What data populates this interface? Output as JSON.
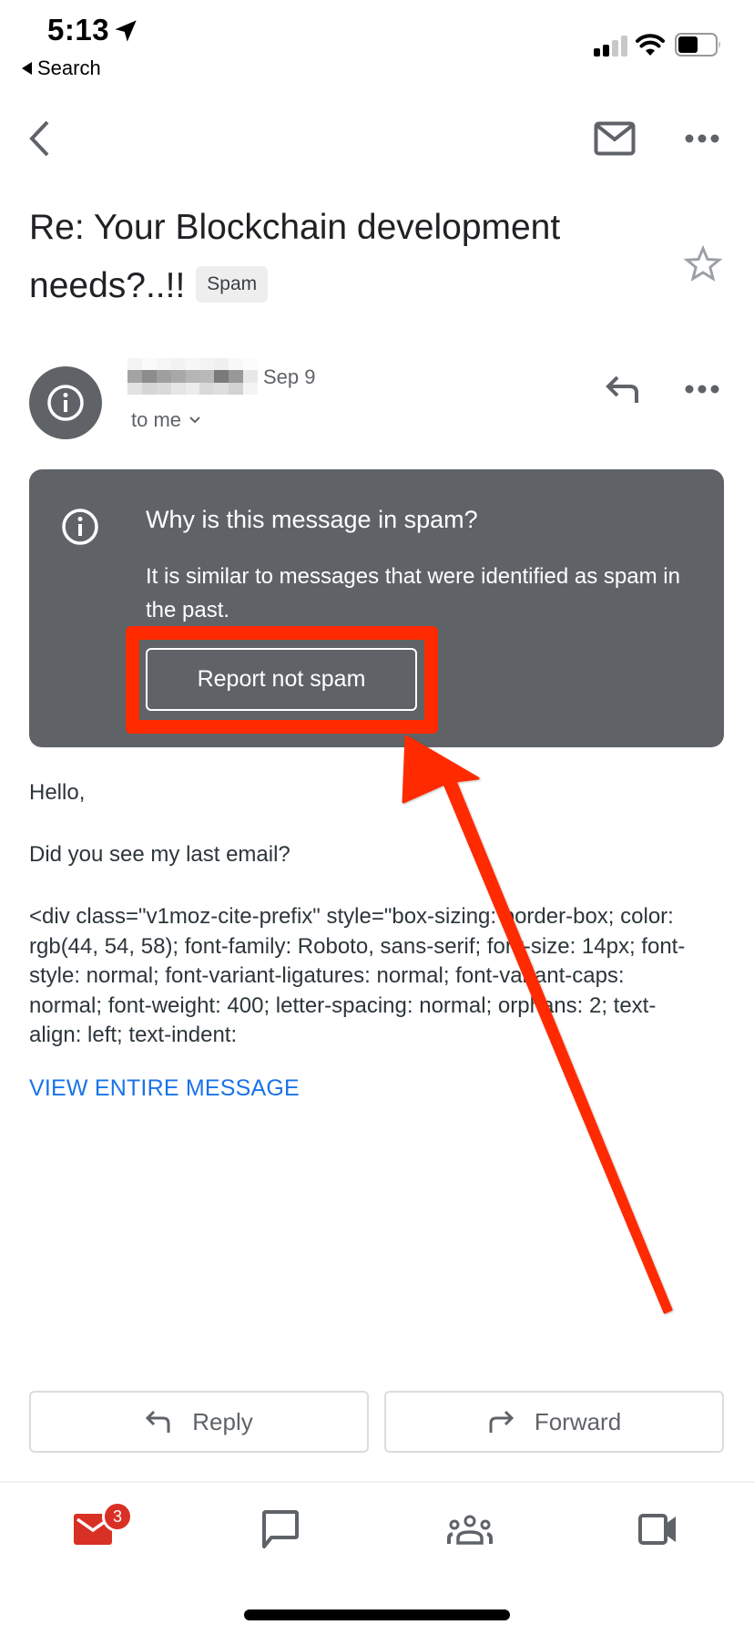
{
  "status_bar": {
    "time": "5:13",
    "back_app_label": "Search",
    "signal_bars_active": 2,
    "signal_bars_total": 4,
    "battery_level_percent": 55,
    "icons": [
      "location-arrow-icon",
      "cellular-signal-icon",
      "wifi-icon",
      "battery-icon"
    ]
  },
  "toolbar": {
    "back_icon": "chevron-left-icon",
    "mark_unread_icon": "mail-icon",
    "more_icon": "more-horizontal-icon"
  },
  "email": {
    "subject": "Re: Your Blockchain development needs?..!!",
    "label_chip": "Spam",
    "starred": false,
    "sender": {
      "name_redacted": true,
      "date": "Sep 9",
      "recipient_label": "to me"
    },
    "spam_notice": {
      "title": "Why is this message in spam?",
      "body": "It is similar to messages that were identified as spam in the past.",
      "action_label": "Report not spam"
    },
    "body": {
      "greeting": "Hello,",
      "question": "Did you see my last email?",
      "code_snippet": "<div class=\"v1moz-cite-prefix\" style=\"box-sizing: border-box; color: rgb(44, 54, 58); font-family: Roboto, sans-serif; font-size: 14px; font-style: normal; font-variant-ligatures: normal; font-variant-caps: normal; font-weight: 400; letter-spacing: normal; orphans: 2; text-align: left; text-indent:",
      "view_entire_label": "VIEW ENTIRE MESSAGE"
    }
  },
  "actions": {
    "reply_label": "Reply",
    "forward_label": "Forward"
  },
  "bottom_nav": {
    "items": [
      {
        "name": "mail",
        "icon": "mail-icon",
        "badge": "3",
        "active": true
      },
      {
        "name": "chat",
        "icon": "chat-bubble-icon",
        "active": false
      },
      {
        "name": "rooms",
        "icon": "group-icon",
        "active": false
      },
      {
        "name": "meet",
        "icon": "video-camera-icon",
        "active": false
      }
    ]
  },
  "annotation": {
    "type": "highlight-with-arrow",
    "target": "Report not spam",
    "color": "#ff2a00"
  },
  "colors": {
    "card_bg": "#5f6368",
    "icon_gray": "#5f6368",
    "link_blue": "#1a73e8",
    "mail_red": "#d93025",
    "star_gray": "#9aa0a6",
    "annotation_red": "#ff2a00"
  }
}
